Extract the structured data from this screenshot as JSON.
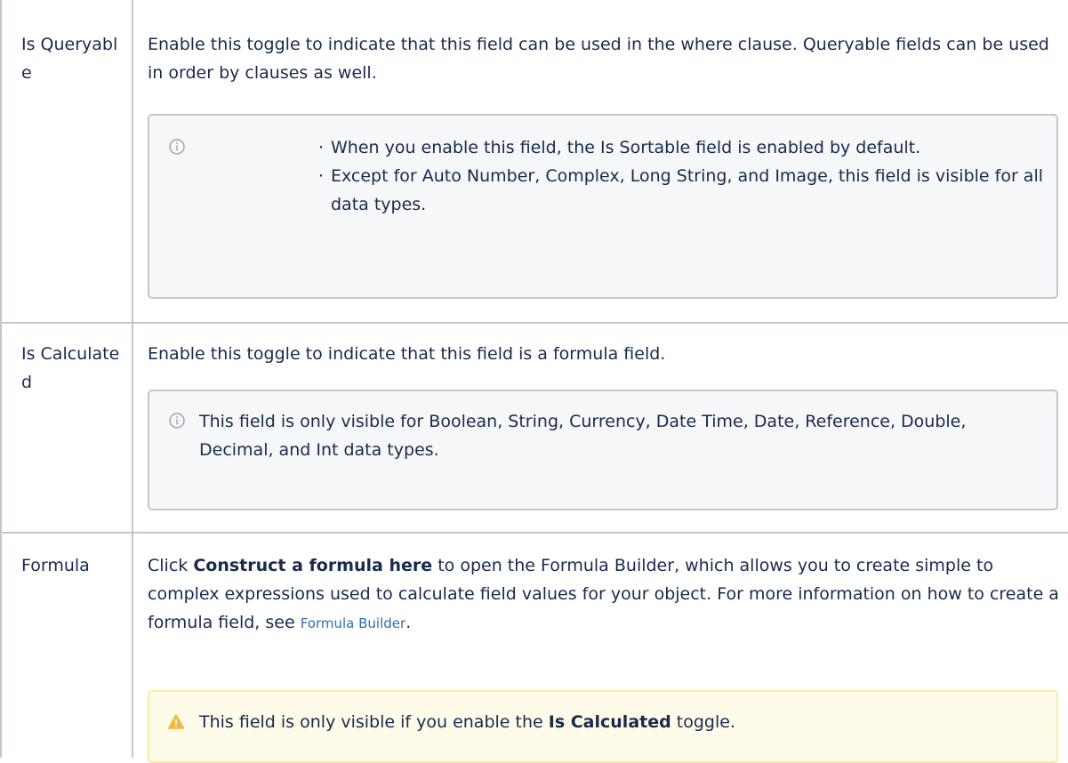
{
  "rows": [
    {
      "label": "Is Queryable",
      "text": "Enable this toggle to indicate that this field can be used in the where clause. Queryable fields can be used in order by clauses as well.",
      "note": {
        "icon": "info-icon",
        "bullets": [
          "When you enable this field, the Is Sortable field is enabled by default.",
          "Except for Auto Number, Complex, Long String, and Image, this field is visible for all data types."
        ]
      }
    },
    {
      "label": "Is Calculated",
      "text": "Enable this toggle to indicate that this field is a formula field.",
      "note": {
        "icon": "info-icon",
        "text": "This field is only visible for Boolean, String, Currency, Date Time, Date, Reference, Double, Decimal, and Int data types."
      }
    },
    {
      "label": "Formula",
      "text_before": "Click ",
      "text_bold": "Construct a formula here",
      "text_after": " to open the Formula Builder, which allows you to create simple to complex expressions used to calculate field values for your object. For more information on how to create a formula field, see ",
      "link": "Formula Builder",
      "text_end": ".",
      "warning": {
        "icon": "warning-icon",
        "text_before": "This field is only visible if you enable the ",
        "text_bold": "Is Calculated",
        "text_after": " toggle."
      }
    }
  ],
  "colors": {
    "border": "#c1c7d0",
    "info_bg": "#f6f7f9",
    "warn_bg": "#fffbe9",
    "warn_border": "#fbe9a6",
    "warn_icon": "#f0b840",
    "link": "#2f6fb0"
  }
}
